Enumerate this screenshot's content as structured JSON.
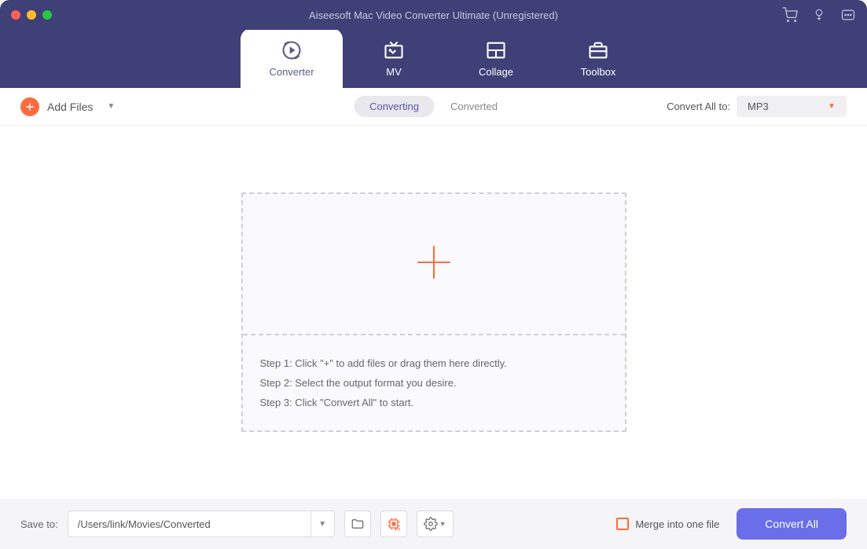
{
  "title": "Aiseesoft Mac Video Converter Ultimate (Unregistered)",
  "tabs": {
    "converter": "Converter",
    "mv": "MV",
    "collage": "Collage",
    "toolbox": "Toolbox"
  },
  "toolbar": {
    "addFiles": "Add Files",
    "converting": "Converting",
    "converted": "Converted",
    "convertAllTo": "Convert All to:",
    "format": "MP3"
  },
  "dropzone": {
    "step1": "Step 1: Click \"+\" to add files or drag them here directly.",
    "step2": "Step 2: Select the output format you desire.",
    "step3": "Step 3: Click \"Convert All\" to start."
  },
  "bottom": {
    "saveTo": "Save to:",
    "path": "/Users/link/Movies/Converted",
    "merge": "Merge into one file",
    "convertAll": "Convert All"
  }
}
